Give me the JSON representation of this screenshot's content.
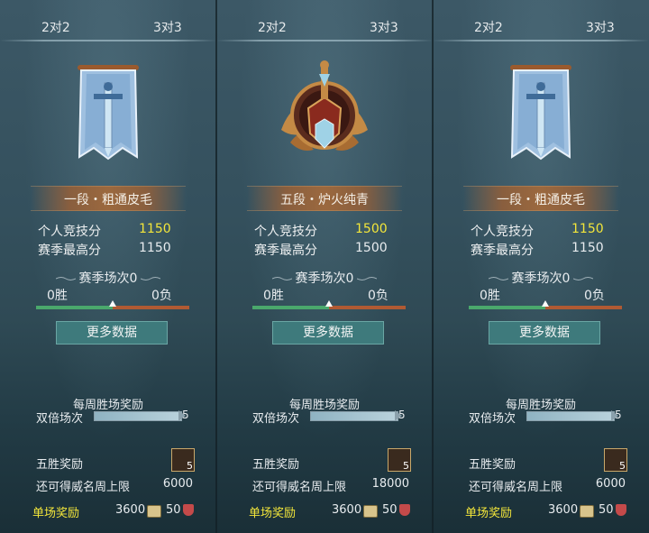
{
  "panels": [
    {
      "tabs": [
        "2对2",
        "3对3"
      ],
      "rank_name": "一段・粗通皮毛",
      "emblem_icon": "banner-sword-icon",
      "personal_label": "个人竞技分",
      "personal_value": "1150",
      "season_best_label": "赛季最高分",
      "season_best_value": "1150",
      "season_matches": "赛季场次0",
      "wins": "0胜",
      "losses": "0负",
      "more_data": "更多数据",
      "weekly_title": "每周胜场奖励",
      "double_label": "双倍场次",
      "double_count": "5",
      "five_win_label": "五胜奖励",
      "chest_count": "5",
      "cap_label": "还可得威名周上限",
      "cap_value": "6000",
      "single_label": "单场奖励",
      "single_coin": "3600",
      "single_honor": "50"
    },
    {
      "tabs": [
        "2对2",
        "3对3"
      ],
      "rank_name": "五段・炉火纯青",
      "emblem_icon": "winged-medal-icon",
      "personal_label": "个人竞技分",
      "personal_value": "1500",
      "season_best_label": "赛季最高分",
      "season_best_value": "1500",
      "season_matches": "赛季场次0",
      "wins": "0胜",
      "losses": "0负",
      "more_data": "更多数据",
      "weekly_title": "每周胜场奖励",
      "double_label": "双倍场次",
      "double_count": "5",
      "five_win_label": "五胜奖励",
      "chest_count": "5",
      "cap_label": "还可得威名周上限",
      "cap_value": "18000",
      "single_label": "单场奖励",
      "single_coin": "3600",
      "single_honor": "50"
    },
    {
      "tabs": [
        "2对2",
        "3对3"
      ],
      "rank_name": "一段・粗通皮毛",
      "emblem_icon": "banner-sword-icon",
      "personal_label": "个人竞技分",
      "personal_value": "1150",
      "season_best_label": "赛季最高分",
      "season_best_value": "1150",
      "season_matches": "赛季场次0",
      "wins": "0胜",
      "losses": "0负",
      "more_data": "更多数据",
      "weekly_title": "每周胜场奖励",
      "double_label": "双倍场次",
      "double_count": "5",
      "five_win_label": "五胜奖励",
      "chest_count": "5",
      "cap_label": "还可得威名周上限",
      "cap_value": "6000",
      "single_label": "单场奖励",
      "single_coin": "3600",
      "single_honor": "50"
    }
  ],
  "colors": {
    "highlight": "#f3e63a",
    "win_bar": "#4aa86c",
    "loss_bar": "#b05a33",
    "button": "#3e7a7c"
  }
}
